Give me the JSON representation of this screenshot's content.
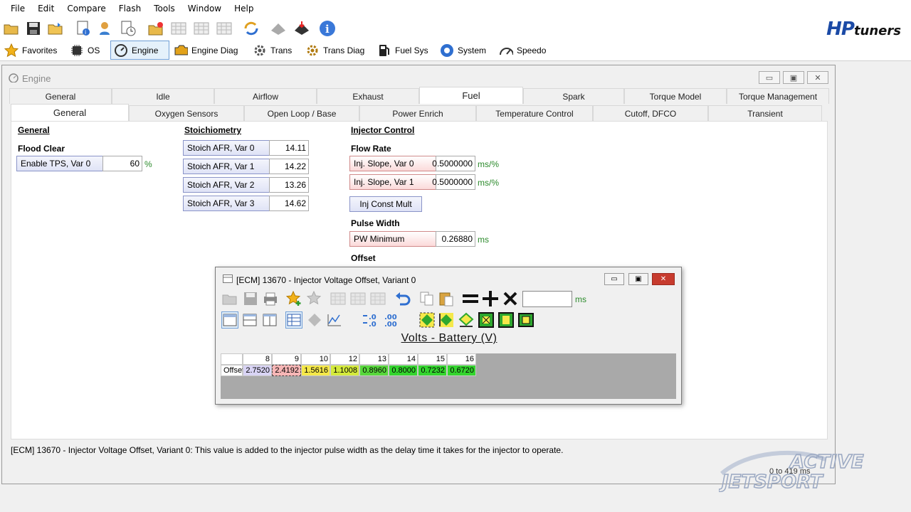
{
  "menu": [
    "File",
    "Edit",
    "Compare",
    "Flash",
    "Tools",
    "Window",
    "Help"
  ],
  "logo": {
    "brand": "HP",
    "suffix": "tuners"
  },
  "nav": [
    {
      "label": "Favorites",
      "icon": "star-icon"
    },
    {
      "label": "OS",
      "icon": "chip-icon"
    },
    {
      "label": "Engine",
      "icon": "engine-gauge-icon",
      "active": true
    },
    {
      "label": "Engine Diag",
      "icon": "engine-diag-icon"
    },
    {
      "label": "Trans",
      "icon": "gear-icon"
    },
    {
      "label": "Trans Diag",
      "icon": "gear-diag-icon"
    },
    {
      "label": "Fuel Sys",
      "icon": "fuel-pump-icon"
    },
    {
      "label": "System",
      "icon": "system-icon"
    },
    {
      "label": "Speedo",
      "icon": "speedometer-icon"
    }
  ],
  "window": {
    "title": "Engine"
  },
  "tabs_top": [
    "General",
    "Idle",
    "Airflow",
    "Exhaust",
    "Fuel",
    "Spark",
    "Torque Model",
    "Torque Management"
  ],
  "tabs_sub": [
    "General",
    "Oxygen Sensors",
    "Open Loop / Base",
    "Power Enrich",
    "Temperature Control",
    "Cutoff, DFCO",
    "Transient"
  ],
  "general": {
    "heading": "General",
    "flood_clear": "Flood Clear",
    "enable_tps_label": "Enable TPS, Var 0",
    "enable_tps_value": "60",
    "enable_tps_unit": "%"
  },
  "stoich": {
    "heading": "Stoichiometry",
    "rows": [
      {
        "label": "Stoich AFR, Var 0",
        "value": "14.11"
      },
      {
        "label": "Stoich AFR, Var 1",
        "value": "14.22"
      },
      {
        "label": "Stoich AFR, Var 2",
        "value": "13.26"
      },
      {
        "label": "Stoich AFR, Var 3",
        "value": "14.62"
      }
    ]
  },
  "injector": {
    "heading": "Injector Control",
    "flow_rate": "Flow Rate",
    "slope0_label": "Inj. Slope, Var 0",
    "slope0_value": "0.5000000",
    "slope0_unit": "ms/%",
    "slope1_label": "Inj. Slope, Var 1",
    "slope1_value": "0.5000000",
    "slope1_unit": "ms/%",
    "const_mult": "Inj Const Mult",
    "pulse_width": "Pulse Width",
    "pw_min_label": "PW Minimum",
    "pw_min_value": "0.26880",
    "pw_min_unit": "ms",
    "offset": "Offset"
  },
  "description": "[ECM] 13670 - Injector Voltage Offset, Variant 0: This value is added to the injector pulse width as the delay time it takes for the injector to operate.",
  "range": "0 to 419 ms",
  "popup": {
    "title": "[ECM] 13670 - Injector Voltage Offset, Variant 0",
    "unit": "ms",
    "axis_label": "Volts - Battery (V)",
    "row_label": "Offset",
    "columns": [
      "8",
      "9",
      "10",
      "12",
      "13",
      "14",
      "15",
      "16"
    ],
    "values": [
      "2.7520",
      "2.4192",
      "1.5616",
      "1.1008",
      "0.8960",
      "0.8000",
      "0.7232",
      "0.6720"
    ],
    "cell_colors": [
      "#d9d4f5",
      "#f7b6b6",
      "#f5e84a",
      "#d4ea3c",
      "#58d83c",
      "#34d52e",
      "#34d52e",
      "#34d52e"
    ]
  },
  "watermark": {
    "line1": "ACTIVE",
    "line2": "JETSPORT"
  }
}
